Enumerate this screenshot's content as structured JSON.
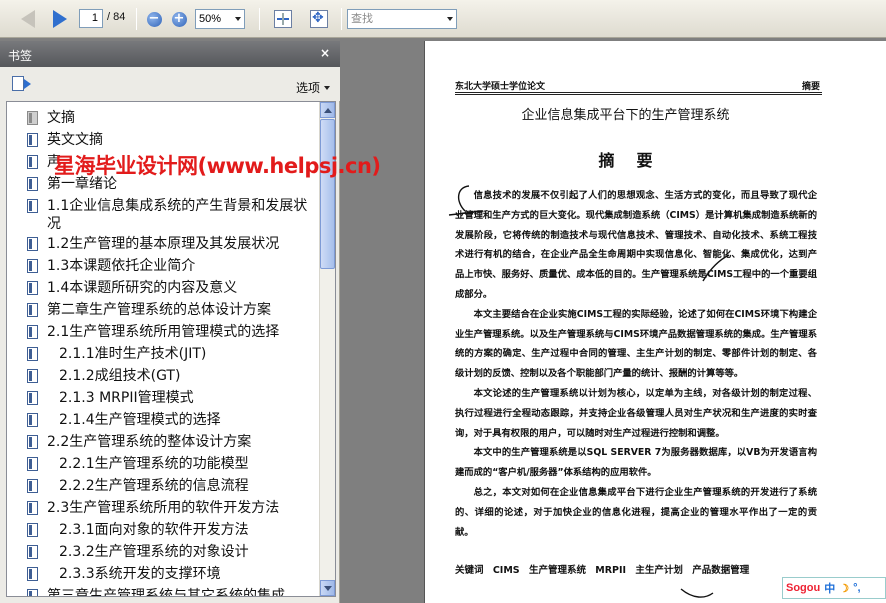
{
  "toolbar": {
    "page_current": "1",
    "page_total": "/ 84",
    "zoom": "50%",
    "find_placeholder": "查找"
  },
  "panel": {
    "title": "书签",
    "close": "×",
    "options_label": "选项"
  },
  "bookmarks": [
    {
      "label": "文摘",
      "level": 0,
      "icon": "gray"
    },
    {
      "label": "英文文摘",
      "level": 0
    },
    {
      "label": "声",
      "level": 0
    },
    {
      "label": "第一章绪论",
      "level": 0
    },
    {
      "label": "1.1企业信息集成系统的产生背景和发展状况",
      "level": 1
    },
    {
      "label": "1.2生产管理的基本原理及其发展状况",
      "level": 1
    },
    {
      "label": "1.3本课题依托企业简介",
      "level": 1
    },
    {
      "label": "1.4本课题所研究的内容及意义",
      "level": 1
    },
    {
      "label": "第二章生产管理系统的总体设计方案",
      "level": 0
    },
    {
      "label": "2.1生产管理系统所用管理模式的选择",
      "level": 1
    },
    {
      "label": "2.1.1准时生产技术(JIT)",
      "level": 2
    },
    {
      "label": "2.1.2成组技术(GT)",
      "level": 2
    },
    {
      "label": "2.1.3 MRPII管理模式",
      "level": 2
    },
    {
      "label": "2.1.4生产管理模式的选择",
      "level": 2
    },
    {
      "label": "2.2生产管理系统的整体设计方案",
      "level": 1
    },
    {
      "label": "2.2.1生产管理系统的功能模型",
      "level": 2
    },
    {
      "label": "2.2.2生产管理系统的信息流程",
      "level": 2
    },
    {
      "label": "2.3生产管理系统所用的软件开发方法",
      "level": 1
    },
    {
      "label": "2.3.1面向对象的软件开发方法",
      "level": 2
    },
    {
      "label": "2.3.2生产管理系统的对象设计",
      "level": 2
    },
    {
      "label": "2.3.3系统开发的支撑环境",
      "level": 2
    },
    {
      "label": "第三章生产管理系统与其它系统的集成",
      "level": 0
    }
  ],
  "watermark": "星海毕业设计网(www.helpsj.cn)",
  "document": {
    "header_left": "东北大学硕士学位论文",
    "header_right": "摘要",
    "title": "企业信息集成平台下的生产管理系统",
    "heading": "摘要",
    "paragraphs": [
      "信息技术的发展不仅引起了人们的思想观念、生活方式的变化，而且导致了现代企业管理和生产方式的巨大变化。现代集成制造系统（CIMS）是计算机集成制造系统新的发展阶段，它将传统的制造技术与现代信息技术、管理技术、自动化技术、系统工程技术进行有机的结合，在企业产品全生命周期中实现信息化、智能化、集成优化，达到产品上市快、服务好、质量优、成本低的目的。生产管理系统是CIMS工程中的一个重要组成部分。",
      "本文主要结合在企业实施CIMS工程的实际经验，论述了如何在CIMS环境下构建企业生产管理系统。以及生产管理系统与CIMS环境产品数据管理系统的集成。生产管理系统的方案的确定、生产过程中合同的管理、主生产计划的制定、零部件计划的制定、各级计划的反馈、控制以及各个职能部门产量的统计、报酬的计算等等。",
      "本文论述的生产管理系统以计划为核心，以定单为主线，对各级计划的制定过程、执行过程进行全程动态跟踪，并支持企业各级管理人员对生产状况和生产进度的实时查询，对于具有权限的用户，可以随时对生产过程进行控制和调整。",
      "本文中的生产管理系统是以SQL SERVER 7为服务器数据库，以VB为开发语言构建而成的“客户机/服务器”体系结构的应用软件。",
      "总之，本文对如何在企业信息集成平台下进行企业生产管理系统的开发进行了系统的、详细的论述，对于加快企业的信息化进程，提高企业的管理水平作出了一定的贡献。"
    ],
    "keywords_label": "关键词",
    "keywords": [
      "CIMS",
      "生产管理系统",
      "MRPII",
      "主生产计划",
      "产品数据管理"
    ]
  },
  "ime": {
    "brand": "Sogou",
    "mode": "中"
  }
}
